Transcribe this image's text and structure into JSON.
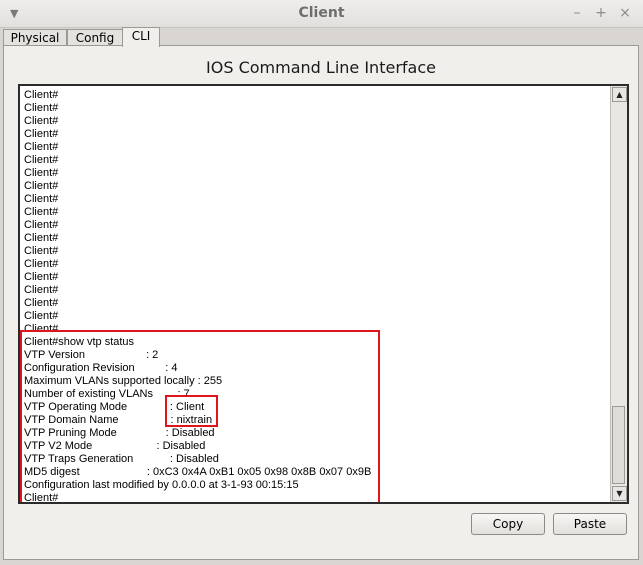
{
  "window": {
    "title": "Client",
    "minimize_symbol": "–",
    "maximize_symbol": "+",
    "close_symbol": "×"
  },
  "tabs": [
    {
      "label": "Physical"
    },
    {
      "label": "Config"
    },
    {
      "label": "CLI"
    }
  ],
  "active_tab": "CLI",
  "panel": {
    "title": "IOS Command Line Interface"
  },
  "terminal": {
    "lines": [
      "Client#",
      "Client#",
      "Client#",
      "Client#",
      "Client#",
      "Client#",
      "Client#",
      "Client#",
      "Client#",
      "Client#",
      "Client#",
      "Client#",
      "Client#",
      "Client#",
      "Client#",
      "Client#",
      "Client#",
      "Client#",
      "Client#",
      "Client#show vtp status",
      "VTP Version                    : 2",
      "Configuration Revision          : 4",
      "Maximum VLANs supported locally : 255",
      "Number of existing VLANs        : 7",
      "VTP Operating Mode              : Client",
      "VTP Domain Name                 : nixtrain",
      "VTP Pruning Mode                : Disabled",
      "VTP V2 Mode                     : Disabled",
      "VTP Traps Generation            : Disabled",
      "MD5 digest                      : 0xC3 0x4A 0xB1 0x05 0x98 0x8B 0x07 0x9B",
      "Configuration last modified by 0.0.0.0 at 3-1-93 00:15:15",
      "Client#"
    ]
  },
  "buttons": {
    "copy": "Copy",
    "paste": "Paste"
  },
  "icons": {
    "scroll_up": "▲",
    "scroll_down": "▼",
    "window_menu": "▼"
  },
  "colors": {
    "highlight": "#e0141b"
  }
}
